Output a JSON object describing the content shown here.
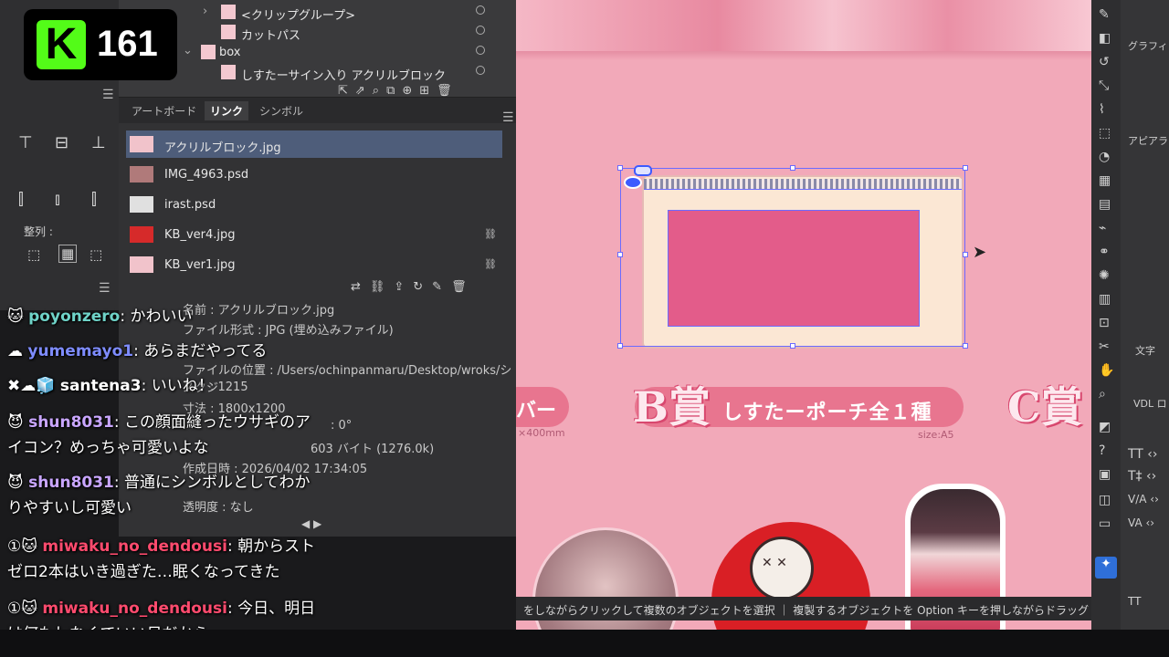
{
  "stream_badge": {
    "viewers": "161",
    "logo_letter": "K",
    "logo_color": "#53fc18"
  },
  "layers": {
    "rows": [
      {
        "name": "<クリップグループ>"
      },
      {
        "name": "カットパス"
      },
      {
        "name": "box"
      },
      {
        "name": "しすたーサイン入り アクリルブロック"
      }
    ]
  },
  "left_strip": {
    "align_label": "整列 :"
  },
  "links_panel": {
    "tabs": [
      "アートボード",
      "リンク",
      "シンボル"
    ],
    "items": [
      {
        "name": "アクリルブロック.jpg"
      },
      {
        "name": "IMG_4963.psd"
      },
      {
        "name": "irast.psd"
      },
      {
        "name": "KB_ver4.jpg"
      },
      {
        "name": "KB_ver1.jpg"
      }
    ],
    "info": {
      "name": "名前 : アクリルブロック.jpg",
      "format": "ファイル形式 : JPG (埋め込みファイル)",
      "location": "ファイルの位置 : /Users/ochinpanmaru/Desktop/wroks/シスクジ",
      "ppi": ": 1215",
      "size": "寸法 : 1800x1200",
      "angle": ": 0°",
      "bytes": "603 バイト (1276.0k)",
      "created": "作成日時 : 2026/04/02 17:34:05",
      "transparency": "透明度 : なし"
    }
  },
  "canvas": {
    "b_title": "B賞",
    "b_subtitle": "しすたーポーチ全１種",
    "b_size": "size:A5",
    "left_pill_text": "バー",
    "left_size": "×400mm",
    "c_title": "C賞",
    "status_text": "をしながらクリックして複数のオブジェクトを選択 ｜ 複製するオブジェクトを Option キーを押しながらドラッグ"
  },
  "chat": [
    {
      "user": "poyonzero",
      "color": "#6fd3c8",
      "message": "かわいい"
    },
    {
      "user": "yumemayo1",
      "color": "#7e8cff",
      "message": "あらまだやってる"
    },
    {
      "user": "santena3",
      "color": "#ffffff",
      "message": "いいね！"
    },
    {
      "user": "shun8031",
      "color": "#c9a6ff",
      "message": "この顔面縫ったウサギのア",
      "cont": "イコン？めっちゃ可愛いよな"
    },
    {
      "user": "shun8031",
      "color": "#c9a6ff",
      "message": "普通にシンボルとしてわか",
      "cont": "りやすいし可愛い"
    },
    {
      "user": "miwaku_no_dendousi",
      "color": "#ff4b6e",
      "message": "朝からスト",
      "cont": "ゼロ2本はいき過ぎた…眠くなってきた"
    },
    {
      "user": "miwaku_no_dendousi",
      "color": "#ff4b6e",
      "message": "今日、明日",
      "cont": "は何もしなくていい日だから。"
    }
  ],
  "right_panel": {
    "label1": "グラフィ",
    "label2": "アピアラ",
    "label3": "文字",
    "label4": "VDL ロ"
  }
}
